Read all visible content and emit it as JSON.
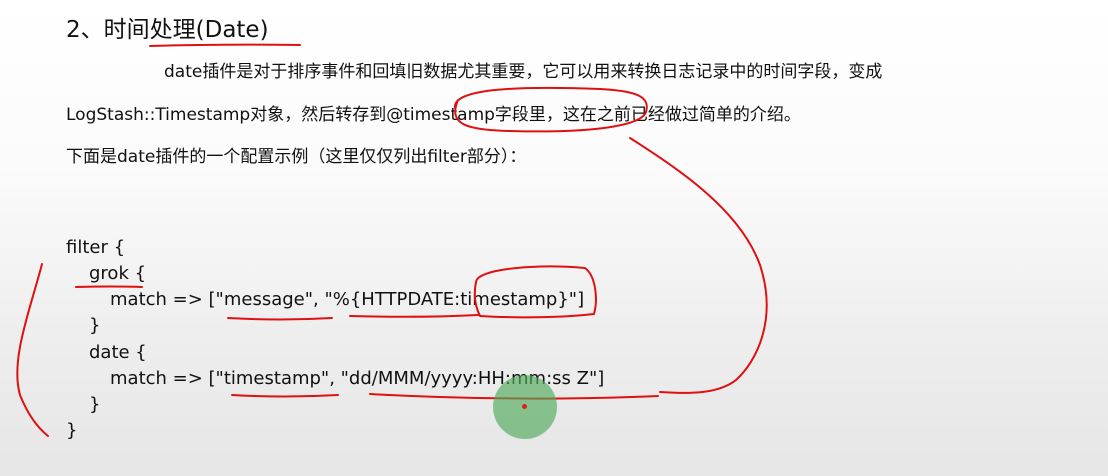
{
  "doc": {
    "heading": "2、时间处理(Date)",
    "para1_line1": "date插件是对于排序事件和回填旧数据尤其重要，它可以用来转换日志记录中的时间字段，变成",
    "para1_line2": "LogStash::Timestamp对象，然后转存到@timestamp字段里，这在之前已经做过简单的介绍。",
    "para2": "下面是date插件的一个配置示例（这里仅仅列出filter部分）：",
    "code_lines": [
      "filter {",
      "grok {",
      "match => [\"message\", \"%{HTTPDATE:timestamp}\"]",
      "}",
      "date {",
      "match => [\"timestamp\", \"dd/MMM/yyyy:HH:mm:ss Z\"]",
      "}",
      "}"
    ]
  },
  "annotation_color": "#e01010"
}
